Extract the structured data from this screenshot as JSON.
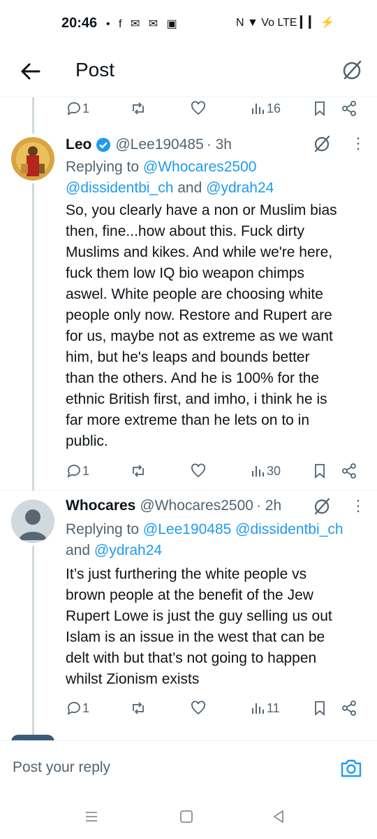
{
  "status_bar": {
    "time": "20:46",
    "left_icons": "• f ✉ ✉ ▣",
    "right_icons": "N ▼ Vo LTE ▎▎ ⚡"
  },
  "header": {
    "title": "Post"
  },
  "top_actions": {
    "replies": "1",
    "views": "16"
  },
  "tweets": [
    {
      "name": "Leo",
      "handle": "@Lee190485",
      "time": "· 3h",
      "replying_label": "Replying to",
      "replying_line1": "@Whocares2500",
      "replying_line2a": "@dissidentbi_ch",
      "replying_and": "and",
      "replying_line2b": "@ydrah24",
      "lines": [
        "So, you clearly have a non or Muslim bias",
        "then, fine...how about this. Fuck dirty",
        "Muslims and kikes. And while we're here,",
        "fuck them low IQ bio weapon chimps",
        "aswel. White people are choosing white",
        "people only now. Restore and Rupert are",
        "for us, maybe not as extreme as we want",
        "him, but he's leaps and bounds better",
        "than the others. And he is 100% for the",
        "ethnic British first, and imho, i think he is",
        "far more extreme than he lets on to in",
        "public."
      ],
      "replies": "1",
      "views": "30"
    },
    {
      "name": "Whocares",
      "handle": "@Whocares2500",
      "time": "· 2h",
      "replying_label": "Replying to",
      "replying_line1": "@Lee190485 @dissidentbi_ch",
      "replying_and": "and",
      "replying_line2b": "@ydrah24",
      "lines": [
        "It’s just furthering the white people vs",
        "brown people at the benefit of the Jew",
        "Rupert Lowe is just the guy selling us out",
        "Islam is an issue in the west that can be",
        "delt with but that’s not going to happen",
        "whilst Zionism exists"
      ],
      "replies": "1",
      "views": "11"
    }
  ],
  "reply_bar": {
    "placeholder": "Post your reply"
  },
  "colors": {
    "accent": "#1d9bf0",
    "muted": "#536471",
    "verified": "#1d9bf0"
  }
}
